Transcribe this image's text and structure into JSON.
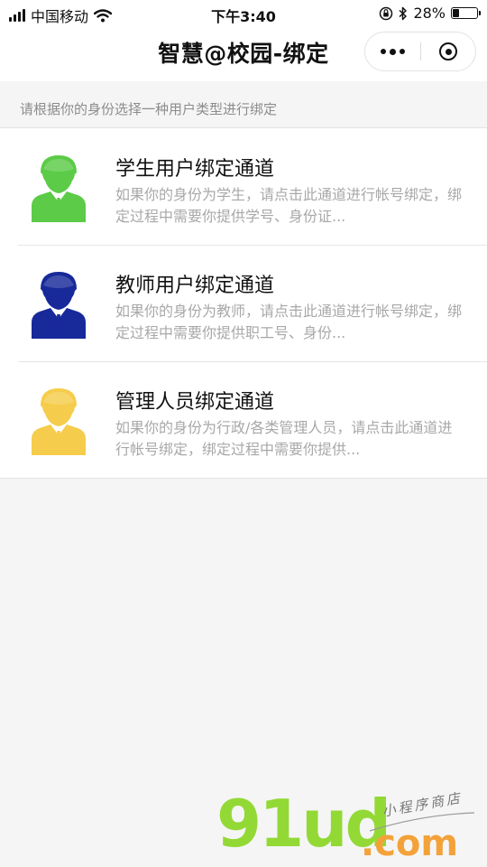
{
  "status_bar": {
    "carrier": "中国移动",
    "time": "下午3:40",
    "battery_level": "28%",
    "battery_fraction": 0.28
  },
  "nav": {
    "title": "智慧@校园-绑定"
  },
  "tip": "请根据你的身份选择一种用户类型进行绑定",
  "channels": [
    {
      "title": "学生用户绑定通道",
      "desc": "如果你的身份为学生，请点击此通道进行帐号绑定，绑定过程中需要你提供学号、身份证...",
      "color": "#5ccb47"
    },
    {
      "title": "教师用户绑定通道",
      "desc": "如果你的身份为教师，请点击此通道进行帐号绑定，绑定过程中需要你提供职工号、身份...",
      "color": "#18299a"
    },
    {
      "title": "管理人员绑定通道",
      "desc": "如果你的身份为行政/各类管理人员，请点击此通道进行帐号绑定，绑定过程中需要你提供...",
      "color": "#f5cc4b"
    }
  ],
  "watermark": {
    "brand": "91ud",
    "suffix": ".com",
    "tagline": "小程序商店"
  },
  "icons": {
    "signal": "signal-icon",
    "wifi": "wifi-icon",
    "lock": "orientation-lock-icon",
    "bluetooth": "bluetooth-icon",
    "battery": "battery-icon",
    "more": "more-dots-icon",
    "close": "close-miniprogram-icon",
    "avatar": "user-avatar-icon"
  }
}
